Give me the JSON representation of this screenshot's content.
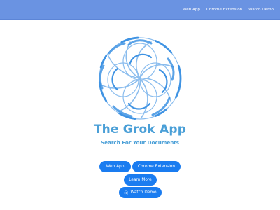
{
  "nav": {
    "links": [
      "Web App",
      "Chrome Extension",
      "Watch Demo"
    ]
  },
  "hero": {
    "title": "The Grok App",
    "subtitle": "Search For Your Documents"
  },
  "buttons": {
    "web_app": "Web App",
    "chrome_extension": "Chrome Extension",
    "learn_more": "Learn More",
    "watch_demo": "Watch Demo"
  },
  "colors": {
    "nav_bg": "#6a93e2",
    "title": "#4a9fd7",
    "button_bg": "#1a7cf0",
    "logo_stroke": "#8bbdee"
  },
  "icons": {
    "logo": "grok-circle-logo-icon",
    "demo": "play-circle-icon"
  }
}
